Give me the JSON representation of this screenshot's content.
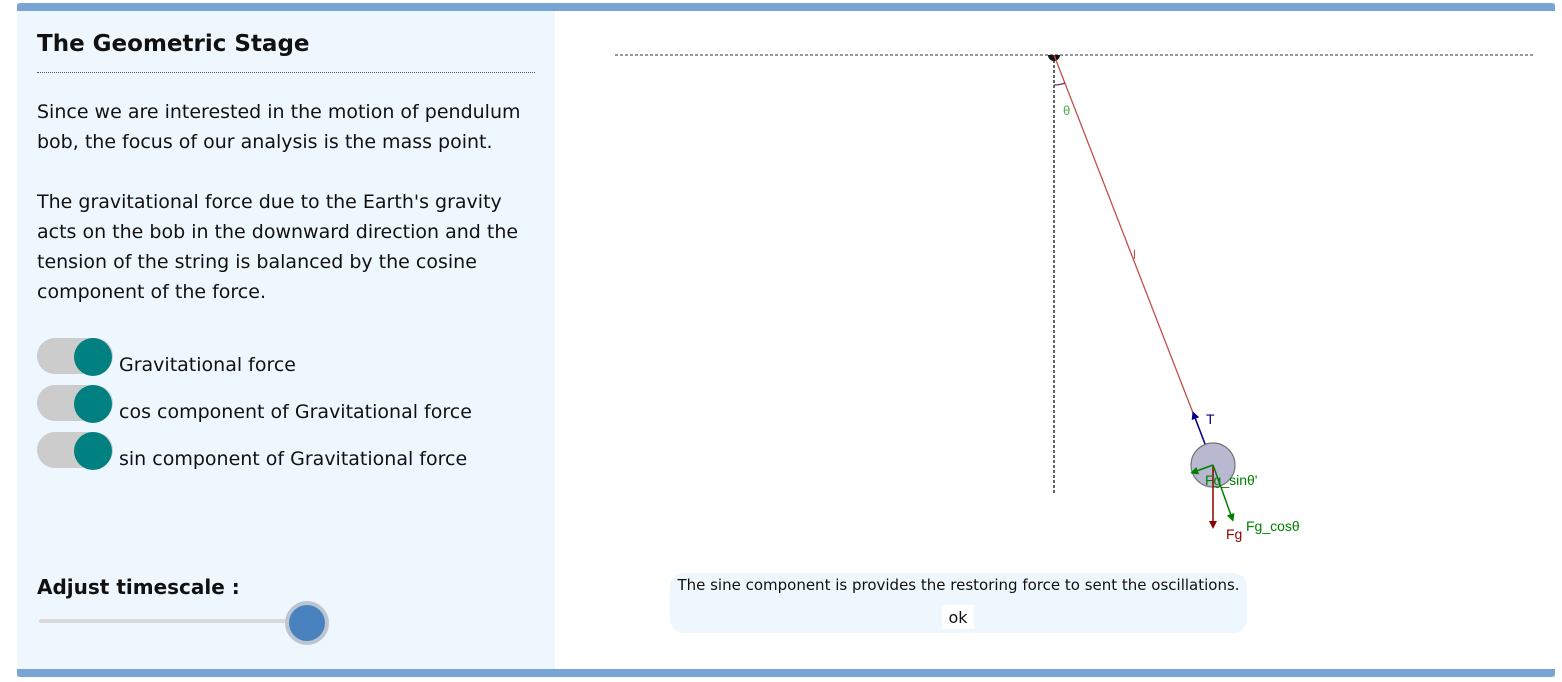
{
  "panel": {
    "title": "The Geometric Stage",
    "paragraph1": "Since we are interested in the motion of pendulum bob, the focus of our analysis is the mass point.",
    "paragraph2": "The gravitational force due to the Earth's gravity acts on the bob in the downward direction and the tension of the string is balanced by the cosine component of the force.",
    "toggles": [
      {
        "label": "Gravitational force",
        "on": true
      },
      {
        "label": "cos component of Gravitational force",
        "on": true
      },
      {
        "label": "sin component of Gravitational force",
        "on": true
      }
    ],
    "timescale_label": "Adjust timescale :",
    "timescale_value": 1.0
  },
  "stage": {
    "labels": {
      "theta": "θ",
      "length": "l",
      "tension": "T",
      "gravity": "Fg",
      "cos_component": "Fg_cosθ",
      "sin_component": "Fg_sinθ'"
    },
    "message": "The sine component is provides the restoring force to sent the oscillations.",
    "ok_label": "ok"
  },
  "colors": {
    "accent_border": "#78a4d6",
    "panel_bg": "#eef6fe",
    "toggle_on": "#008080",
    "slider_thumb": "#4a82c0",
    "string": "#c0504d",
    "tension": "#00008b",
    "gravity": "#8b0000",
    "component": "#008000",
    "bob": "#b8b8d1"
  }
}
